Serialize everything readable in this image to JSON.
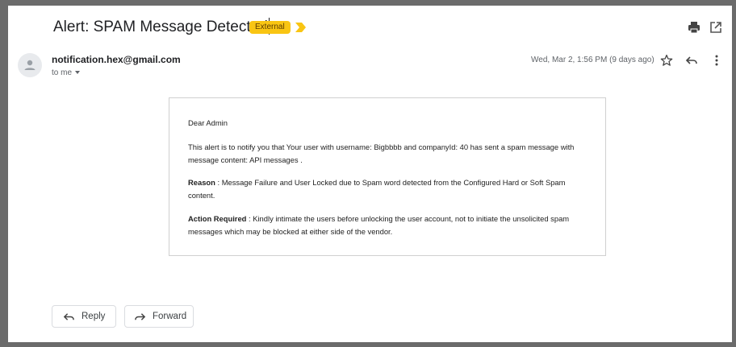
{
  "email": {
    "subject": "Alert: SPAM Message Detected",
    "label": "External",
    "sender": "notification.hex@gmail.com",
    "recipient": "to me",
    "date": "Wed, Mar 2, 1:56 PM (9 days ago)"
  },
  "body": {
    "greeting": "Dear Admin",
    "intro": "This alert is to notify you that Your user with username: Bigbbbb and companyId: 40 has sent a spam message with message content: API messages .",
    "reason_label": "Reason",
    "reason_text": " : Message Failure and User Locked due to Spam word detected from the Configured Hard or Soft Spam content.",
    "action_label": "Action Required",
    "action_text": " : Kindly intimate the users before unlocking the user account, not to initiate the unsolicited spam messages which may be blocked at either side of the vendor."
  },
  "actions": {
    "reply": "Reply",
    "forward": "Forward"
  },
  "colors": {
    "label_bg": "#f9c513",
    "important_marker": "#f9c513",
    "frame": "#6b6b6b"
  },
  "icons": [
    "print-icon",
    "open-in-new-window-icon",
    "star-icon",
    "reply-icon",
    "more-options-icon",
    "important-marker-icon",
    "avatar-person-icon",
    "forward-icon"
  ]
}
